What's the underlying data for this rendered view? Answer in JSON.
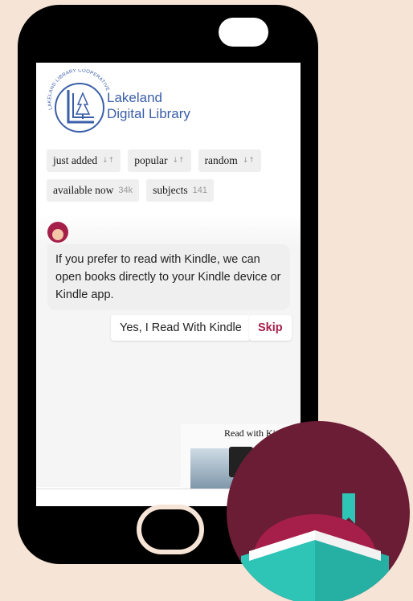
{
  "logo": {
    "arc_text": "LAKELAND LIBRARY COOPERATIVE",
    "line1": "Lakeland",
    "line2": "Digital Library"
  },
  "filters": [
    {
      "label": "just added",
      "icon": "sort-icon"
    },
    {
      "label": "popular",
      "icon": "sort-icon"
    },
    {
      "label": "random",
      "icon": "sort-icon"
    },
    {
      "label": "available now",
      "count": "34k"
    },
    {
      "label": "subjects",
      "count": "141"
    }
  ],
  "chat": {
    "message": "If you prefer to read with Kindle, we can open books directly to your Kindle device or Kindle app.",
    "kindle_button": "Yes, I Read With Kindle",
    "skip_button": "Skip"
  },
  "promo": {
    "text": "Read with Kindle"
  },
  "colors": {
    "background": "#f6e4d6",
    "accent": "#a61f4a",
    "badge_bg": "#6b1d36",
    "book_teal": "#2ec4b6",
    "logo_blue": "#3a5ea8"
  }
}
